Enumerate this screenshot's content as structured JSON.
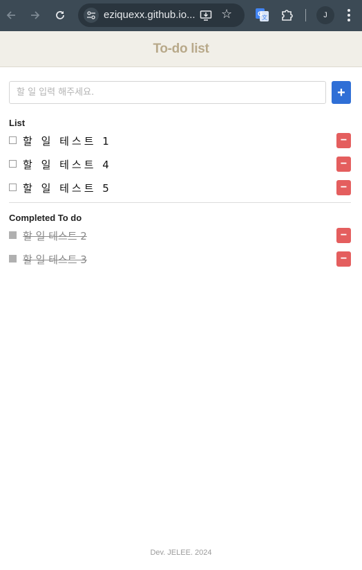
{
  "browser": {
    "url": "eziquexx.github.io...",
    "profile_initial": "J",
    "icons": [
      "back-arrow-icon",
      "forward-arrow-icon",
      "reload-icon",
      "site-settings-icon",
      "install-app-icon",
      "bookmark-star-icon",
      "translate-icon",
      "extensions-puzzle-icon",
      "more-vert-icon"
    ]
  },
  "app": {
    "title": "To-do list",
    "input_placeholder": "할 일 입력 해주세요.",
    "input_value": "",
    "add_label": "+",
    "list_title": "List",
    "completed_title": "Completed To do",
    "remove_label": "−",
    "todos": [
      {
        "text": "할 일 테스트 1",
        "done": false
      },
      {
        "text": "할 일 테스트 4",
        "done": false
      },
      {
        "text": "할 일 테스트 5",
        "done": false
      }
    ],
    "completed": [
      {
        "text": "할 일 테스트 2",
        "done": true
      },
      {
        "text": "할 일 테스트 3",
        "done": true
      }
    ],
    "footer": "Dev. JELEE. 2024"
  },
  "colors": {
    "header_bg": "#f1efe8",
    "title": "#b8a98a",
    "add_button": "#2f6fd6",
    "remove_button": "#e45e5e",
    "chrome_bg": "#3c4a55"
  }
}
